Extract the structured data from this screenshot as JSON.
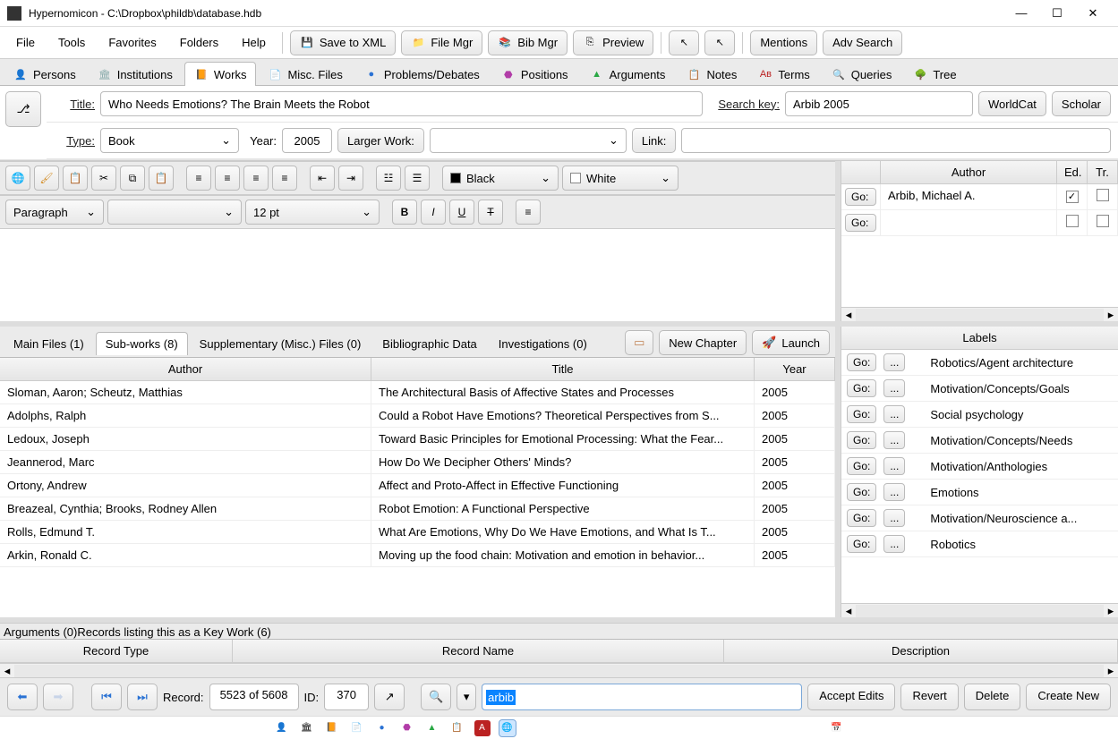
{
  "window": {
    "title": "Hypernomicon - C:\\Dropbox\\phildb\\database.hdb"
  },
  "menu": {
    "file": "File",
    "tools": "Tools",
    "favorites": "Favorites",
    "folders": "Folders",
    "help": "Help"
  },
  "toolbar": {
    "save_xml": "Save to XML",
    "file_mgr": "File Mgr",
    "bib_mgr": "Bib Mgr",
    "preview": "Preview",
    "mentions": "Mentions",
    "adv_search": "Adv Search"
  },
  "tabs": [
    {
      "label": "Persons",
      "icon": "👤",
      "color": "#666"
    },
    {
      "label": "Institutions",
      "icon": "🏛",
      "color": "#8aa"
    },
    {
      "label": "Works",
      "icon": "📙",
      "color": "#c60",
      "active": true
    },
    {
      "label": "Misc. Files",
      "icon": "📄",
      "color": "#789"
    },
    {
      "label": "Problems/Debates",
      "icon": "●",
      "color": "#2a72d4"
    },
    {
      "label": "Positions",
      "icon": "⬣",
      "color": "#b23da8"
    },
    {
      "label": "Arguments",
      "icon": "▲",
      "color": "#2aa845"
    },
    {
      "label": "Notes",
      "icon": "📋",
      "color": "#c9a24a"
    },
    {
      "label": "Terms",
      "icon": "Aв",
      "color": "#b22"
    },
    {
      "label": "Queries",
      "icon": "🔍",
      "color": "#888"
    },
    {
      "label": "Tree",
      "icon": "🌳",
      "color": "#888"
    }
  ],
  "form": {
    "title_label": "Title:",
    "title_value": "Who Needs Emotions? The Brain Meets the Robot",
    "search_key_label": "Search key:",
    "search_key_value": "Arbib 2005",
    "worldcat": "WorldCat",
    "scholar": "Scholar",
    "type_label": "Type:",
    "type_value": "Book",
    "year_label": "Year:",
    "year_value": "2005",
    "larger_work": "Larger Work:",
    "link_label": "Link:"
  },
  "editor": {
    "color_fg": "Black",
    "color_bg": "White",
    "style": "Paragraph",
    "size": "12 pt"
  },
  "authors": {
    "go": "Go:",
    "header": {
      "author": "Author",
      "ed": "Ed.",
      "tr": "Tr."
    },
    "rows": [
      {
        "name": "Arbib, Michael A.",
        "ed": true,
        "tr": false
      }
    ]
  },
  "subtabs": {
    "main_files": "Main Files (1)",
    "sub_works": "Sub-works (8)",
    "supp": "Supplementary (Misc.) Files (0)",
    "bib": "Bibliographic Data",
    "invest": "Investigations (0)",
    "new_chapter": "New Chapter",
    "launch": "Launch"
  },
  "subworks": {
    "headers": {
      "author": "Author",
      "title": "Title",
      "year": "Year"
    },
    "rows": [
      {
        "author": "Sloman, Aaron; Scheutz, Matthias",
        "title": "The Architectural Basis of Affective States and Processes",
        "year": "2005"
      },
      {
        "author": "Adolphs, Ralph",
        "title": "Could a Robot Have Emotions? Theoretical Perspectives from S...",
        "year": "2005"
      },
      {
        "author": "Ledoux, Joseph",
        "title": "Toward Basic Principles for Emotional Processing: What the Fear...",
        "year": "2005"
      },
      {
        "author": "Jeannerod, Marc",
        "title": "How Do We Decipher Others' Minds?",
        "year": "2005"
      },
      {
        "author": "Ortony, Andrew",
        "title": "Affect and Proto-Affect in Effective Functioning",
        "year": "2005"
      },
      {
        "author": "Breazeal, Cynthia; Brooks, Rodney Allen",
        "title": "Robot Emotion: A Functional Perspective",
        "year": "2005"
      },
      {
        "author": "Rolls, Edmund T.",
        "title": "What Are Emotions, Why Do We Have Emotions, and What Is T...",
        "year": "2005"
      },
      {
        "author": "Arkin, Ronald C.",
        "title": "Moving up the food chain: Motivation and emotion in behavior...",
        "year": "2005"
      }
    ]
  },
  "labels": {
    "header": "Labels",
    "go": "Go:",
    "dots": "...",
    "rows": [
      "Robotics/Agent architecture",
      "Motivation/Concepts/Goals",
      "Social psychology",
      "Motivation/Concepts/Needs",
      "Motivation/Anthologies",
      "Emotions",
      "Motivation/Neuroscience a...",
      "Robotics"
    ]
  },
  "bottom": {
    "arguments": "Arguments (0)",
    "records_listing": "Records listing this as a Key Work (6)",
    "record_type": "Record Type",
    "record_name": "Record Name",
    "description": "Description"
  },
  "nav": {
    "record_label": "Record:",
    "record_value": "5523 of 5608",
    "id_label": "ID:",
    "id_value": "370",
    "search_text": "arbib",
    "accept": "Accept Edits",
    "revert": "Revert",
    "delete": "Delete",
    "create_new": "Create New"
  }
}
